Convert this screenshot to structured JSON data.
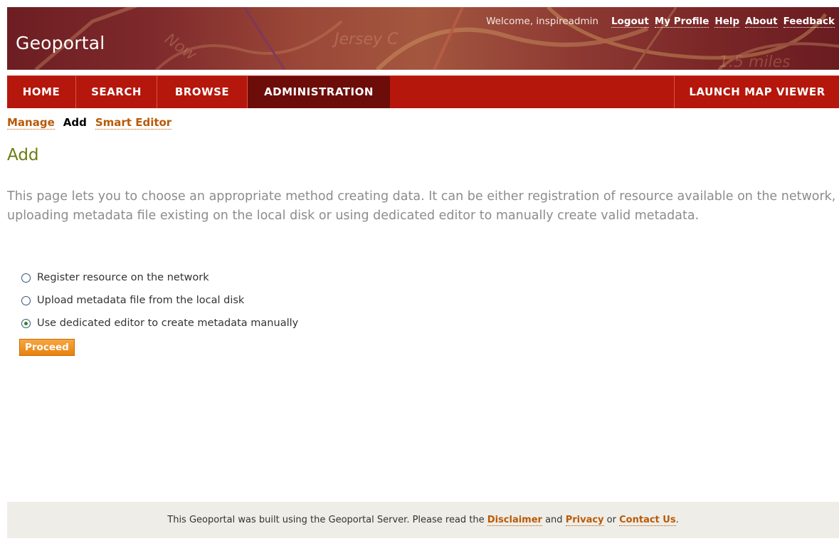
{
  "header": {
    "site_title": "Geoportal",
    "welcome": "Welcome, inspireadmin",
    "links": [
      "Logout",
      "My Profile",
      "Help",
      "About",
      "Feedback"
    ]
  },
  "nav": {
    "tabs": [
      "HOME",
      "SEARCH",
      "BROWSE",
      "ADMINISTRATION"
    ],
    "active": "ADMINISTRATION",
    "right_tab": "LAUNCH MAP VIEWER"
  },
  "subnav": {
    "manage": "Manage",
    "add": "Add",
    "smart_editor": "Smart Editor"
  },
  "page": {
    "title": "Add",
    "description": "This page lets you to choose an appropriate method creating data. It can be either registration of resource available on the network, uploading metadata file existing on the local disk or using dedicated editor to manually create valid metadata.",
    "options": [
      {
        "label": "Register resource on the network",
        "checked": false
      },
      {
        "label": "Upload metadata file from the local disk",
        "checked": false
      },
      {
        "label": "Use dedicated editor to create metadata manually",
        "checked": true
      }
    ],
    "proceed_label": "Proceed"
  },
  "footer": {
    "text_before": "This Geoportal was built using the Geoportal Server. Please read the",
    "disclaimer": "Disclaimer",
    "and": "and",
    "privacy": "Privacy",
    "or": "or",
    "contact": "Contact Us",
    "period": "."
  },
  "colors": {
    "nav_bg": "#b5170c",
    "nav_active": "#6d0d0a",
    "link": "#b85a08",
    "title": "#6a7d12",
    "button": "#e8820e"
  }
}
